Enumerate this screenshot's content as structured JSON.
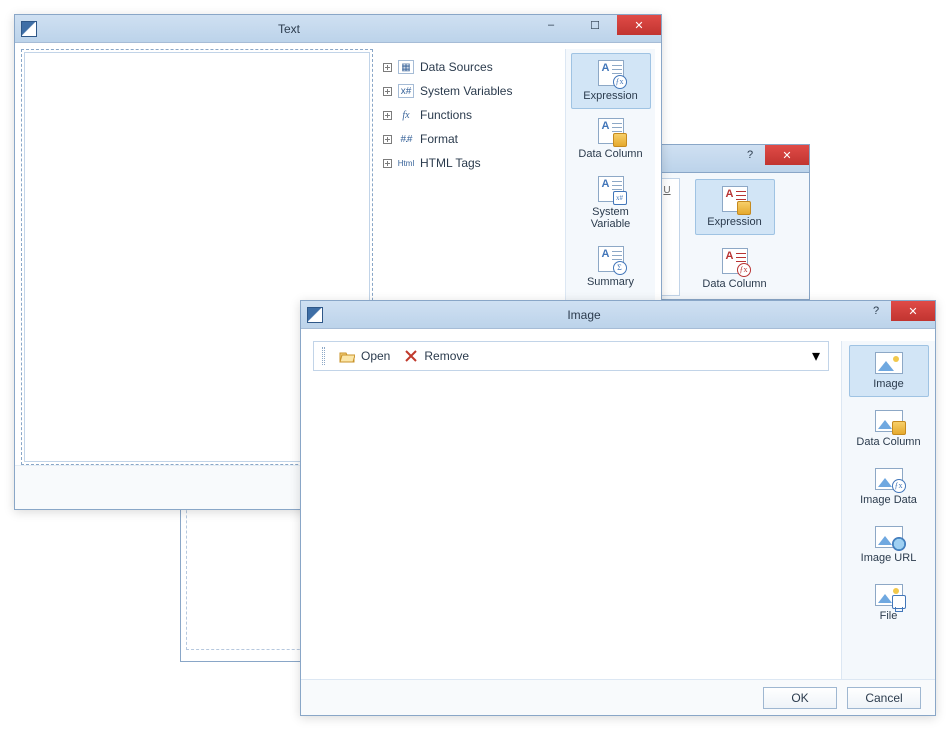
{
  "text_window": {
    "title": "Text",
    "editor_value": "",
    "tree": [
      {
        "icon": "data-sources",
        "label": "Data Sources"
      },
      {
        "icon": "system-vars",
        "label": "System Variables"
      },
      {
        "icon": "fx",
        "label": "Functions"
      },
      {
        "icon": "format",
        "label": "Format"
      },
      {
        "icon": "html",
        "label": "HTML Tags"
      }
    ],
    "sidebar": [
      {
        "key": "expression",
        "label": "Expression",
        "selected": true
      },
      {
        "key": "data-column",
        "label": "Data Column"
      },
      {
        "key": "sys-var",
        "label": "System Variable"
      },
      {
        "key": "summary",
        "label": "Summary"
      }
    ],
    "win_buttons": {
      "min": "–",
      "max": "☐",
      "close": "✕"
    }
  },
  "back_window": {
    "help": "?",
    "close": "✕",
    "underline_sample": "U",
    "sidebar": [
      {
        "key": "expression",
        "label": "Expression",
        "selected": true
      },
      {
        "key": "data-column",
        "label": "Data Column"
      }
    ]
  },
  "image_window": {
    "title": "Image",
    "help": "?",
    "close": "✕",
    "toolbar": {
      "open": "Open",
      "remove": "Remove"
    },
    "sidebar": [
      {
        "key": "image",
        "label": "Image",
        "selected": true
      },
      {
        "key": "data-column",
        "label": "Data Column"
      },
      {
        "key": "image-data",
        "label": "Image Data"
      },
      {
        "key": "image-url",
        "label": "Image URL"
      },
      {
        "key": "file",
        "label": "File"
      }
    ],
    "buttons": {
      "ok": "OK",
      "cancel": "Cancel"
    }
  }
}
